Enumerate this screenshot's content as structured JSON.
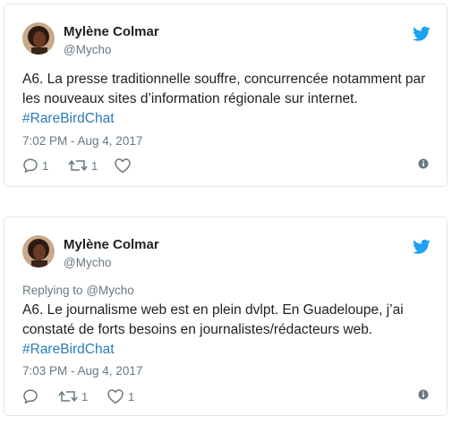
{
  "tweets": [
    {
      "author_name": "Mylène Colmar",
      "author_handle": "@Mycho",
      "replying_to_label": "",
      "replying_to_handle": "",
      "text": "A6. La presse traditionnelle souffre, concurrencée notamment par les nouveaux sites d’information régionale sur internet.",
      "hashtag": "#RareBirdChat",
      "timestamp": "7:02 PM - Aug 4, 2017",
      "reply_count": "1",
      "retweet_count": "1",
      "like_count": ""
    },
    {
      "author_name": "Mylène Colmar",
      "author_handle": "@Mycho",
      "replying_to_label": "Replying to",
      "replying_to_handle": "@Mycho",
      "text": "A6. Le journalisme web est en plein dvlpt. En Guadeloupe, j’ai constaté de forts besoins en journalistes/rédacteurs web.",
      "hashtag": "#RareBirdChat",
      "timestamp": "7:03 PM - Aug 4, 2017",
      "reply_count": "",
      "retweet_count": "1",
      "like_count": "1"
    }
  ],
  "icons": {
    "brand": "twitter-bird-icon",
    "reply": "reply-icon",
    "retweet": "retweet-icon",
    "like": "heart-icon",
    "info": "info-icon"
  },
  "colors": {
    "brand": "#1da1f2",
    "text": "#1c2022",
    "muted": "#697882",
    "link": "#2b7bb9",
    "border": "#e1e8ed"
  }
}
